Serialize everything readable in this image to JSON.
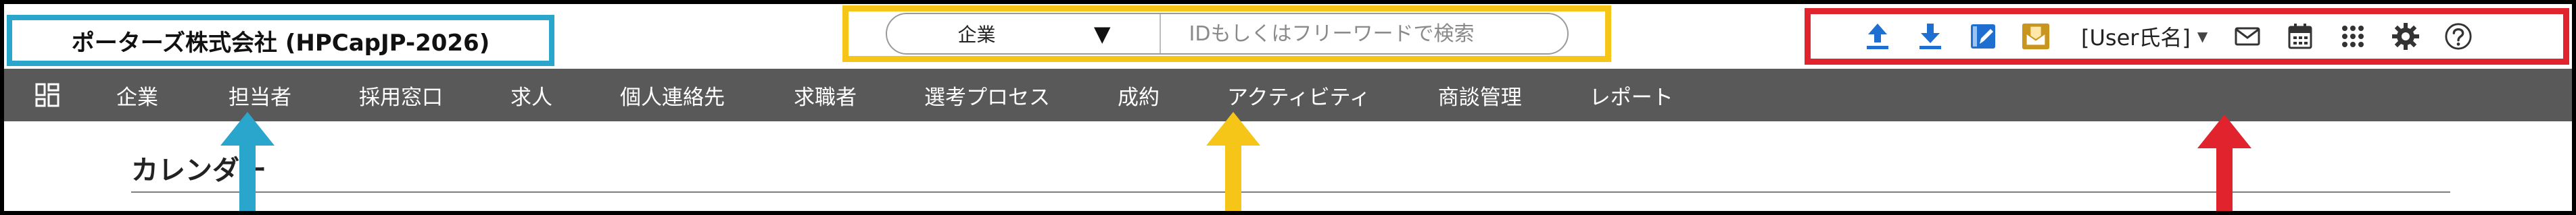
{
  "header": {
    "company_name": "ポーターズ株式会社 (HPCapJP-2026)",
    "search": {
      "category": "企業",
      "placeholder": "IDもしくはフリーワードで検索"
    },
    "tools": {
      "icons": [
        "upload-icon",
        "download-icon",
        "note-icon",
        "mail-tray-icon"
      ],
      "user_name": "[User氏名]",
      "right_icons": [
        "mail-icon",
        "calendar-icon",
        "apps-grid-icon",
        "settings-icon",
        "help-icon"
      ]
    }
  },
  "nav": {
    "items": [
      {
        "label": "企業"
      },
      {
        "label": "担当者"
      },
      {
        "label": "採用窓口"
      },
      {
        "label": "求人"
      },
      {
        "label": "個人連絡先"
      },
      {
        "label": "求職者"
      },
      {
        "label": "選考プロセス"
      },
      {
        "label": "成約"
      },
      {
        "label": "アクティビティ"
      },
      {
        "label": "商談管理"
      },
      {
        "label": "レポート"
      }
    ]
  },
  "main": {
    "page_title": "カレンダー"
  },
  "colors": {
    "company_box": "#2aa5cc",
    "search_box": "#f5c518",
    "tools_box": "#e0232d",
    "nav_bg": "#595959",
    "icon_blue": "#1f6fd1",
    "icon_gold": "#c8961e"
  }
}
